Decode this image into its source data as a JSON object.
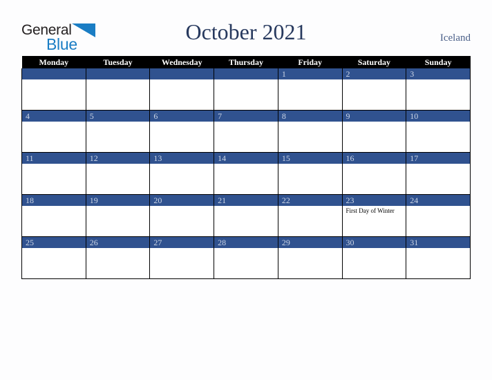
{
  "brand": {
    "word_dark": "General",
    "word_blue": "Blue",
    "triangle_color": "#1a7dc4",
    "dark_color": "#231f20"
  },
  "header": {
    "title": "October 2021",
    "country": "Iceland",
    "title_color": "#27395e",
    "country_color": "#4a5f88"
  },
  "calendar": {
    "header_bg": "#000000",
    "header_fg": "#ffffff",
    "daybar_bg": "#30528f",
    "daynum_fg": "#cdd6e6",
    "cell_bg": "#ffffff",
    "weekday_headers": [
      "Monday",
      "Tuesday",
      "Wednesday",
      "Thursday",
      "Friday",
      "Saturday",
      "Sunday"
    ],
    "weeks": [
      [
        {
          "day": "",
          "blank": true,
          "event": ""
        },
        {
          "day": "",
          "blank": true,
          "event": ""
        },
        {
          "day": "",
          "blank": true,
          "event": ""
        },
        {
          "day": "",
          "blank": true,
          "event": ""
        },
        {
          "day": "1",
          "blank": false,
          "event": ""
        },
        {
          "day": "2",
          "blank": false,
          "event": ""
        },
        {
          "day": "3",
          "blank": false,
          "event": ""
        }
      ],
      [
        {
          "day": "4",
          "blank": false,
          "event": ""
        },
        {
          "day": "5",
          "blank": false,
          "event": ""
        },
        {
          "day": "6",
          "blank": false,
          "event": ""
        },
        {
          "day": "7",
          "blank": false,
          "event": ""
        },
        {
          "day": "8",
          "blank": false,
          "event": ""
        },
        {
          "day": "9",
          "blank": false,
          "event": ""
        },
        {
          "day": "10",
          "blank": false,
          "event": ""
        }
      ],
      [
        {
          "day": "11",
          "blank": false,
          "event": ""
        },
        {
          "day": "12",
          "blank": false,
          "event": ""
        },
        {
          "day": "13",
          "blank": false,
          "event": ""
        },
        {
          "day": "14",
          "blank": false,
          "event": ""
        },
        {
          "day": "15",
          "blank": false,
          "event": ""
        },
        {
          "day": "16",
          "blank": false,
          "event": ""
        },
        {
          "day": "17",
          "blank": false,
          "event": ""
        }
      ],
      [
        {
          "day": "18",
          "blank": false,
          "event": ""
        },
        {
          "day": "19",
          "blank": false,
          "event": ""
        },
        {
          "day": "20",
          "blank": false,
          "event": ""
        },
        {
          "day": "21",
          "blank": false,
          "event": ""
        },
        {
          "day": "22",
          "blank": false,
          "event": ""
        },
        {
          "day": "23",
          "blank": false,
          "event": "First Day of Winter"
        },
        {
          "day": "24",
          "blank": false,
          "event": ""
        }
      ],
      [
        {
          "day": "25",
          "blank": false,
          "event": ""
        },
        {
          "day": "26",
          "blank": false,
          "event": ""
        },
        {
          "day": "27",
          "blank": false,
          "event": ""
        },
        {
          "day": "28",
          "blank": false,
          "event": ""
        },
        {
          "day": "29",
          "blank": false,
          "event": ""
        },
        {
          "day": "30",
          "blank": false,
          "event": ""
        },
        {
          "day": "31",
          "blank": false,
          "event": ""
        }
      ]
    ]
  }
}
